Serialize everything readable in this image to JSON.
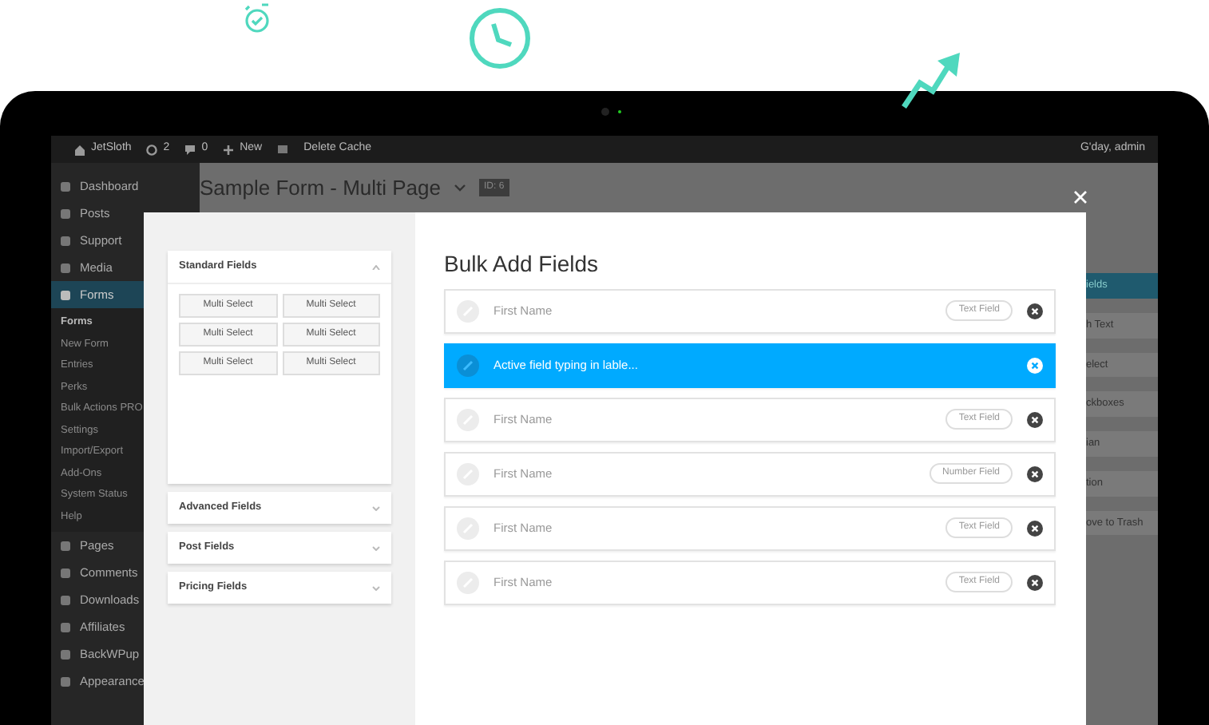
{
  "admin_bar": {
    "site": "JetSloth",
    "updates": "2",
    "comments": "0",
    "new": "New",
    "cache": "Delete Cache",
    "greeting": "G'day, admin"
  },
  "sidebar": {
    "items": [
      {
        "label": "Dashboard",
        "selected": false
      },
      {
        "label": "Posts",
        "selected": false
      },
      {
        "label": "Support",
        "selected": false
      },
      {
        "label": "Media",
        "selected": false
      },
      {
        "label": "Forms",
        "selected": true,
        "children": [
          {
            "label": "Forms",
            "selected": true
          },
          {
            "label": "New Form",
            "selected": false
          },
          {
            "label": "Entries",
            "selected": false
          },
          {
            "label": "Perks",
            "selected": false
          },
          {
            "label": "Bulk Actions PRO",
            "selected": false
          },
          {
            "label": "Settings",
            "selected": false
          },
          {
            "label": "Import/Export",
            "selected": false
          },
          {
            "label": "Add-Ons",
            "selected": false
          },
          {
            "label": "System Status",
            "selected": false
          },
          {
            "label": "Help",
            "selected": false
          }
        ]
      },
      {
        "label": "Pages",
        "selected": false
      },
      {
        "label": "Comments",
        "selected": false
      },
      {
        "label": "Downloads",
        "selected": false
      },
      {
        "label": "Affiliates",
        "selected": false
      },
      {
        "label": "BackWPup",
        "selected": false
      },
      {
        "label": "Appearance",
        "selected": false
      }
    ]
  },
  "page": {
    "title": "Sample Form - Multi Page",
    "id_badge": "ID: 6"
  },
  "background_fragments": [
    "ields",
    "h Text",
    "elect",
    "ckboxes",
    "ian",
    "tion",
    "ove to Trash"
  ],
  "modal": {
    "title": "Bulk Add Fields",
    "panels": [
      {
        "title": "Standard Fields",
        "expanded": true,
        "buttons": [
          "Multi Select",
          "Multi Select",
          "Multi Select",
          "Multi Select",
          "Multi Select",
          "Multi Select"
        ]
      },
      {
        "title": "Advanced Fields",
        "expanded": false
      },
      {
        "title": "Post Fields",
        "expanded": false
      },
      {
        "title": "Pricing Fields",
        "expanded": false
      }
    ],
    "fields": [
      {
        "label": "First Name",
        "type": "Text Field",
        "selected": false
      },
      {
        "label": "Active field typing in lable...",
        "selected": true
      },
      {
        "label": "First Name",
        "type": "Text Field",
        "selected": false
      },
      {
        "label": "First Name",
        "type": "Number Field",
        "selected": false
      },
      {
        "label": "First Name",
        "type": "Text Field",
        "selected": false
      },
      {
        "label": "First Name",
        "type": "Text Field",
        "selected": false
      }
    ]
  }
}
